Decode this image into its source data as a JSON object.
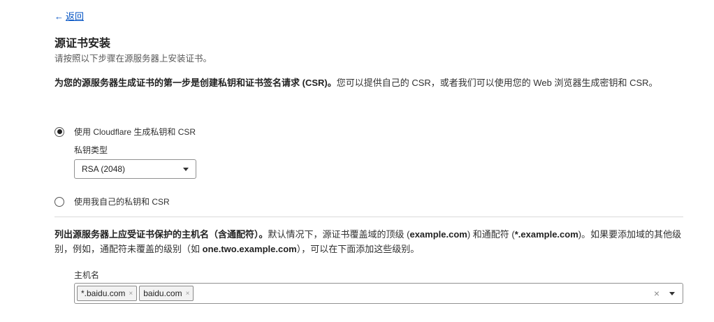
{
  "back": {
    "arrow": "←",
    "label": "返回"
  },
  "header": {
    "title": "源证书安装",
    "subtitle": "请按照以下步骤在源服务器上安装证书。"
  },
  "intro": {
    "bold": "为您的源服务器生成证书的第一步是创建私钥和证书签名请求 (CSR)。",
    "text": "您可以提供自己的 CSR，或者我们可以使用您的 Web 浏览器生成密钥和 CSR。"
  },
  "options": {
    "cloudflare": {
      "label": "使用 Cloudflare 生成私钥和 CSR",
      "selected": true
    },
    "own": {
      "label": "使用我自己的私钥和 CSR",
      "selected": false
    }
  },
  "key_type": {
    "label": "私钥类型",
    "value": "RSA (2048)"
  },
  "hostnames": {
    "desc_bold": "列出源服务器上应受证书保护的主机名（含通配符）。",
    "desc_1": "默认情况下，源证书覆盖域的顶级 (",
    "apex": "example.com",
    "desc_2": ") 和通配符 (",
    "wildcard": "*.example.com",
    "desc_3": ")。如果要添加域的其他级别，例如，通配符未覆盖的级别（如 ",
    "example_level": "one.two.example.com",
    "desc_4": "），可以在下面添加这些级别。",
    "label": "主机名",
    "tags": [
      "*.baidu.com",
      "baidu.com"
    ],
    "tag_remove_glyph": "×",
    "clear_glyph": "×"
  },
  "icons": {
    "back": "arrow-left-icon",
    "select_caret": "caret-down-icon",
    "tag_remove": "close-icon",
    "clear": "close-icon"
  },
  "colors": {
    "link": "#0051c3",
    "text": "#313131",
    "border": "#919191"
  }
}
